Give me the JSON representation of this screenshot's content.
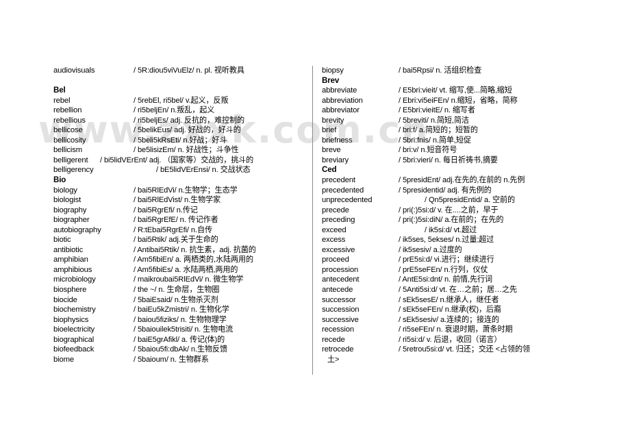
{
  "watermark": {
    "text": "www.zxxk.com.cn"
  },
  "columns": {
    "left": {
      "entries": [
        {
          "type": "entry",
          "word": "audiovisuals",
          "defn": "/ 5R:diou5viVuElz/    n. pl. 视听教具",
          "width": "w-std"
        },
        {
          "type": "spacer",
          "word": "",
          "defn": "",
          "width": "w-std"
        },
        {
          "type": "group",
          "word": "Bel",
          "defn": "",
          "width": "w-std"
        },
        {
          "type": "entry",
          "word": "rebel",
          "defn": "/ 5rebEl, ri5bel/   v.起义，反叛",
          "width": "w-std"
        },
        {
          "type": "entry",
          "word": "rebellion",
          "defn": "/ ri5beljEn/   n.叛乱，起义",
          "width": "w-std"
        },
        {
          "type": "entry",
          "word": "rebellious",
          "defn": "/ ri5beljEs/   adj. 反抗的，难控制的",
          "width": "w-std"
        },
        {
          "type": "entry",
          "word": "bellicose",
          "defn": "/ 5belikEus/   adj. 好战的，好斗的",
          "width": "w-std"
        },
        {
          "type": "entry",
          "word": "bellicosity",
          "defn": "/ 5beli5kRsEti/   n.好战；好斗",
          "width": "w-std"
        },
        {
          "type": "entry",
          "word": "bellicism",
          "defn": "/ be5lisizEm/    n. 好战性；斗争性",
          "width": "w-std"
        },
        {
          "type": "entry",
          "word": "belligerent",
          "defn": "/ bi5lidVErEnt/   adj. （国家等）交战的，挑斗的",
          "width": "w-tight"
        },
        {
          "type": "entry",
          "word": "belligerency",
          "defn": "/ bE5lidVErEnsi/   n. 交战状态",
          "width": "w-wide"
        },
        {
          "type": "group",
          "word": "Bio",
          "defn": "",
          "width": "w-std"
        },
        {
          "type": "entry",
          "word": "biology",
          "defn": "/ bai5RlEdVi/   n.生物学；生态学",
          "width": "w-std"
        },
        {
          "type": "entry",
          "word": "biologist",
          "defn": "/ bai5RlEdVist/   n.生物学家",
          "width": "w-std"
        },
        {
          "type": "entry",
          "word": "biography",
          "defn": "/ bai5RgrEfi/   n.传记",
          "width": "w-std"
        },
        {
          "type": "entry",
          "word": "biographer",
          "defn": "/ bai5RgrEfE/   n. 传记作者",
          "width": "w-std"
        },
        {
          "type": "entry",
          "word": "autobiography",
          "defn": "/ R:tEbai5RgrEfi/   n.自传",
          "width": "w-std"
        },
        {
          "type": "entry",
          "word": "biotic",
          "defn": "/ bai5Rtik/     adj.关于生命的",
          "width": "w-std"
        },
        {
          "type": "entry",
          "word": "antibiotic",
          "defn": "/ Antibai5Rtik/   n. 抗生素，adj. 抗菌的",
          "width": "w-std"
        },
        {
          "type": "entry",
          "word": "amphibian",
          "defn": "/ Am5fibiEn/   a. 两栖类的,水陆两用的",
          "width": "w-std"
        },
        {
          "type": "entry",
          "word": "amphibious",
          "defn": "/ Am5fibiEs/   a. 水陆两栖,两用的",
          "width": "w-std"
        },
        {
          "type": "entry",
          "word": "microbiology",
          "defn": "/ maikroubai5RlEdVi/   n. 微生物学",
          "width": "w-std"
        },
        {
          "type": "entry",
          "word": "biosphere",
          "defn": "/ the ~/   n. 生命层，生物圈",
          "width": "w-std"
        },
        {
          "type": "entry",
          "word": "biocide",
          "defn": "/ 5baiEsaid/   n.生物杀灭剂",
          "width": "w-std"
        },
        {
          "type": "entry",
          "word": "biochemistry",
          "defn": "/ baiEu5kZmistri/   n. 生物化学",
          "width": "w-std"
        },
        {
          "type": "entry",
          "word": "biophysics",
          "defn": "/ baiou5fiziks/   n. 生物物理学",
          "width": "w-std"
        },
        {
          "type": "entry",
          "word": "bioelectricity",
          "defn": "/ 5baiouilek5trisiti/    n. 生物电流",
          "width": "w-std"
        },
        {
          "type": "entry",
          "word": "biographical",
          "defn": "/ baiE5grAfikl/   a. 传记(体)的",
          "width": "w-std"
        },
        {
          "type": "entry",
          "word": "biofeedback",
          "defn": "/ 5baiou5fi:dbAk/   n.生物反馈",
          "width": "w-std"
        },
        {
          "type": "entry",
          "word": "biome",
          "defn": "/ 5baioum/   n. 生物群系",
          "width": "w-std"
        }
      ]
    },
    "right": {
      "entries": [
        {
          "type": "entry",
          "word": "biopsy",
          "defn": "/ bai5Rpsi/   n. 活组织检查",
          "width": "w-stdR"
        },
        {
          "type": "group",
          "word": "Brev",
          "defn": "",
          "width": "w-stdR"
        },
        {
          "type": "entry",
          "word": "abbreviate",
          "defn": "/ E5bri:vieit/   vt. 缩写,使...简略,缩短",
          "width": "w-stdR"
        },
        {
          "type": "entry",
          "word": "abbreviation",
          "defn": "/ Ebri:vi5eiFEn/   n.缩短，省略，简称",
          "width": "w-stdR"
        },
        {
          "type": "entry",
          "word": "abbreviator",
          "defn": "/ E5bri:vieitE/   n. 缩写者",
          "width": "w-stdR"
        },
        {
          "type": "entry",
          "word": "brevity",
          "defn": "/ 5breviti/   n.简短,简洁",
          "width": "w-stdR"
        },
        {
          "type": "entry",
          "word": "brief",
          "defn": "/ bri:f/   a.简短的；短暂的",
          "width": "w-stdR"
        },
        {
          "type": "entry",
          "word": "briefness",
          "defn": "/ 5bri:fnis/   n.简单,短促",
          "width": "w-stdR"
        },
        {
          "type": "entry",
          "word": "breve",
          "defn": "/ bri:v/   n.短音符号",
          "width": "w-stdR"
        },
        {
          "type": "entry",
          "word": "breviary",
          "defn": "/ 5bri:vieri/   n. 每日祈祷书,摘要",
          "width": "w-stdR"
        },
        {
          "type": "group",
          "word": "Ced",
          "defn": "",
          "width": "w-stdR"
        },
        {
          "type": "entry",
          "word": "precedent",
          "defn": "/ 5presidEnt/   adj.在先的,在前的 n.先例",
          "width": "w-stdR"
        },
        {
          "type": "entry",
          "word": "precedented",
          "defn": "/ 5presidentid/    adj. 有先例的",
          "width": "w-stdR"
        },
        {
          "type": "entry",
          "word": "unprecedented",
          "defn": "/ Qn5presidEntid/   a. 空前的",
          "width": "w-wide"
        },
        {
          "type": "entry",
          "word": "precede",
          "defn": "/ pri(:)5si:d/   v. 在....之前，早于",
          "width": "w-stdR"
        },
        {
          "type": "entry",
          "word": "preceding",
          "defn": "/ pri(:)5si:diN/   a.在前的；在先的",
          "width": "w-stdR"
        },
        {
          "type": "entry",
          "word": "exceed",
          "defn": "/ ik5si:d/   vt.超过",
          "width": "w-wide"
        },
        {
          "type": "entry",
          "word": "excess",
          "defn": "/ ik5ses, 5ekses/   n.过量;超过",
          "width": "w-stdR"
        },
        {
          "type": "entry",
          "word": "excessive",
          "defn": "/ ik5sesiv/   a.过度的",
          "width": "w-stdR"
        },
        {
          "type": "entry",
          "word": "proceed",
          "defn": "/ prE5si:d/   vi.进行；继续进行",
          "width": "w-stdR"
        },
        {
          "type": "entry",
          "word": "procession",
          "defn": "/ prE5seFEn/   n.行列，仪仗",
          "width": "w-stdR"
        },
        {
          "type": "entry",
          "word": "antecedent",
          "defn": "/ AntE5si:dnt/   n. 前情,先行词",
          "width": "w-stdR"
        },
        {
          "type": "entry",
          "word": "antecede",
          "defn": "/ 5Anti5si:d/    vt. 在…之前；居…之先",
          "width": "w-stdR"
        },
        {
          "type": "entry",
          "word": "successor",
          "defn": "/ sEk5sesE/   n.继承人，继任者",
          "width": "w-stdR"
        },
        {
          "type": "entry",
          "word": "succession",
          "defn": "/ sEk5seFEn/   n.继承(权)，后裔",
          "width": "w-stdR"
        },
        {
          "type": "entry",
          "word": "successive",
          "defn": "/ sEk5sesiv/   a.连续的；接连的",
          "width": "w-stdR"
        },
        {
          "type": "entry",
          "word": "recession",
          "defn": "/ ri5seFEn/   n. 衰退时期，萧条时期",
          "width": "w-stdR"
        },
        {
          "type": "entry",
          "word": "recede",
          "defn": "/ ri5si:d/   v. 后退，收回（诺言）",
          "width": "w-stdR"
        },
        {
          "type": "entry",
          "word": "retrocede",
          "defn": "/ 5retrou5si:d/    vt. 归还；交还 <占领的领",
          "width": "w-stdR"
        },
        {
          "type": "cont",
          "word": "",
          "defn": "土>",
          "width": "w-none"
        }
      ]
    }
  }
}
